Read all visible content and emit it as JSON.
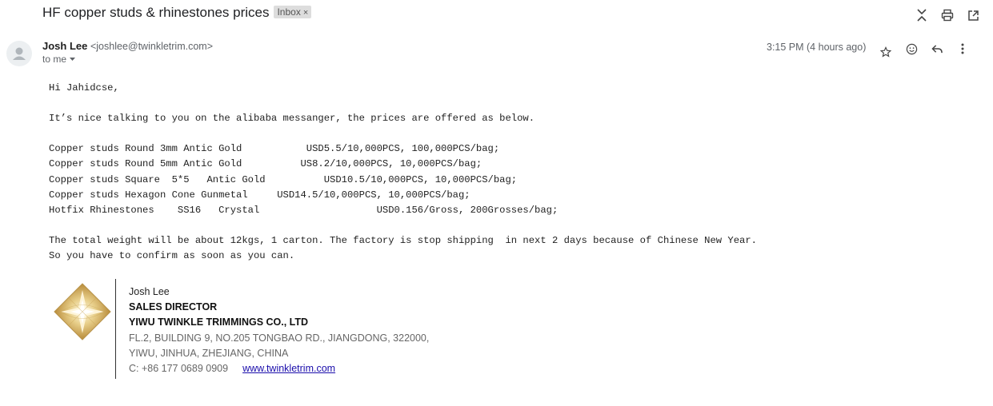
{
  "header": {
    "subject": "HF copper studs & rhinestones prices",
    "label": "Inbox",
    "label_close": "×"
  },
  "message": {
    "sender_name": "Josh Lee",
    "sender_email": "<joshlee@twinkletrim.com>",
    "to": "to me",
    "time": "3:15 PM (4 hours ago)"
  },
  "body": {
    "greeting": "Hi Jahidcse,",
    "intro": "It’s nice talking to you on the alibaba messanger, the prices are offered as below.",
    "items": [
      "Copper studs Round 3mm Antic Gold           USD5.5/10,000PCS, 100,000PCS/bag;",
      "Copper studs Round 5mm Antic Gold          US8.2/10,000PCS, 10,000PCS/bag;",
      "Copper studs Square  5*5   Antic Gold          USD10.5/10,000PCS, 10,000PCS/bag;",
      "Copper studs Hexagon Cone Gunmetal     USD14.5/10,000PCS, 10,000PCS/bag;",
      "Hotfix Rhinestones    SS16   Crystal                    USD0.156/Gross, 200Grosses/bag;"
    ],
    "closing_1": "The total weight will be about 12kgs, 1 carton. The factory is stop shipping  in next 2 days because of Chinese New Year.",
    "closing_2": "So you have to confirm as soon as you can."
  },
  "signature": {
    "name": "Josh Lee",
    "title": "SALES DIRECTOR",
    "company": "YIWU TWINKLE TRIMMINGS CO., LTD",
    "address_1": "FL.2, BUILDING 9, NO.205 TONGBAO RD., JIANGDONG, 322000,",
    "address_2": "YIWU, JINHUA, ZHEJIANG, CHINA",
    "phone": "C: +86 177 0689 0909",
    "website": "www.twinkletrim.com"
  },
  "icons": {
    "top": [
      "collapse-icon",
      "print-icon",
      "open-new-window-icon"
    ],
    "message": [
      "star-icon",
      "emoji-icon",
      "reply-icon",
      "more-vertical-icon"
    ]
  },
  "colors": {
    "link": "#1a0dab",
    "logo_gold": "#c9a24a"
  }
}
